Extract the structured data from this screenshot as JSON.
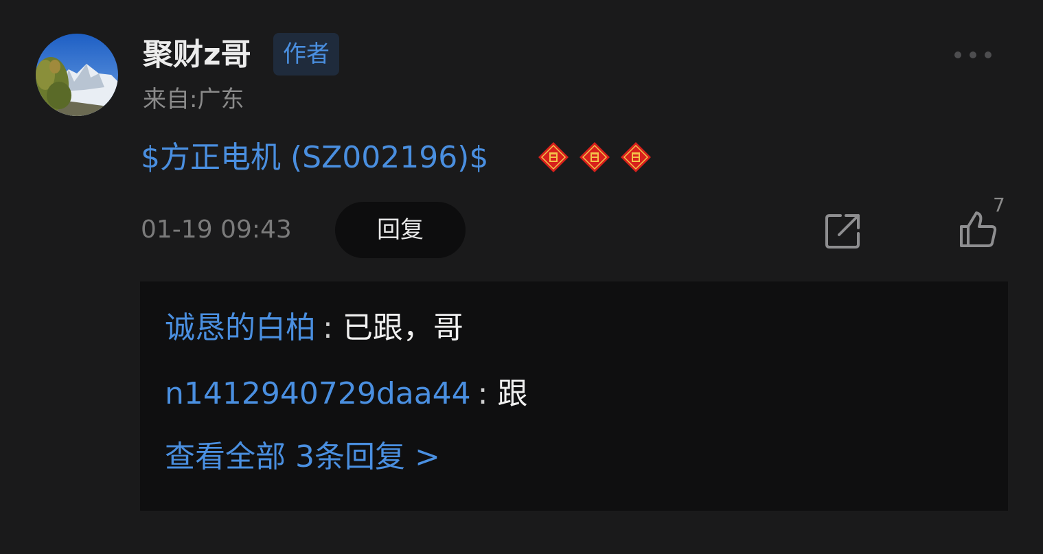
{
  "post": {
    "username": "聚财z哥",
    "author_badge": "作者",
    "location": "来自:广东",
    "stock_link": "$方正电机 (SZ002196)$",
    "emoji": [
      "fu-emoji",
      "fu-emoji",
      "fu-emoji"
    ],
    "timestamp": "01-19 09:43",
    "reply_label": "回复",
    "like_count": "7",
    "icons": {
      "more": "more-dots-icon",
      "share": "share-icon",
      "like": "thumbs-up-icon"
    }
  },
  "replies": {
    "items": [
      {
        "author": "诚恳的白柏",
        "separator": ":",
        "text": "已跟，哥"
      },
      {
        "author": "n1412940729daa44",
        "separator": ":",
        "text": "跟"
      }
    ],
    "view_all": "查看全部 3条回复 >"
  },
  "colors": {
    "background": "#1a1a1b",
    "accent": "#4a8fe0",
    "reply_box": "#0f0f10"
  }
}
